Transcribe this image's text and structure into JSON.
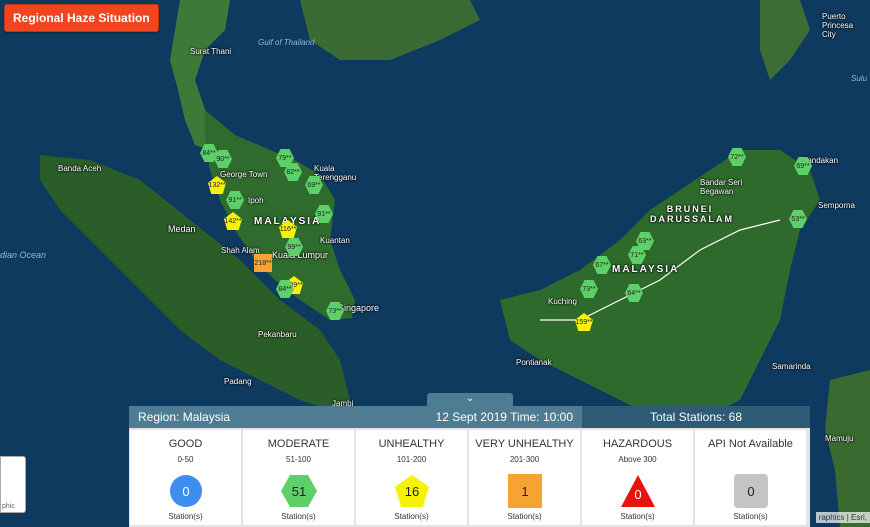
{
  "app": {
    "title_button": "Regional Haze Situation"
  },
  "map": {
    "labels": {
      "gulf": "Gulf of Thailand",
      "surat_thani": "Surat Thani",
      "banda_aceh": "Banda Aceh",
      "medan": "Medan",
      "indian_ocean": "dian Ocean",
      "malaysia_west": "MALAYSIA",
      "george_town": "George Town",
      "ipoh": "Ipoh",
      "kuala_terengganu": "Kuala Terengganu",
      "kuantan": "Kuantan",
      "shah_alam": "Shah Alam",
      "kuala_lumpur": "Kuala Lumpur",
      "singapore": "Singapore",
      "pekanbaru": "Pekanbaru",
      "padang": "Padang",
      "jambi": "Jambi",
      "pontianak": "Pontianak",
      "kuching": "Kuching",
      "malaysia_east": "MALAYSIA",
      "brunei": "BRUNEI DARUSSALAM",
      "bandar": "Bandar Seri Begawan",
      "sandakan": "Sandakan",
      "semporna": "Semporna",
      "samarinda": "Samarinda",
      "mamuju": "Mamuju",
      "puerto": "Puerto Princesa City",
      "sulu": "Sulu"
    },
    "stations": [
      {
        "v": "84**",
        "c": "good"
      },
      {
        "v": "90**",
        "c": "good"
      },
      {
        "v": "132**",
        "c": "unhealthy"
      },
      {
        "v": "91**",
        "c": "good"
      },
      {
        "v": "142**",
        "c": "unhealthy"
      },
      {
        "v": "79**",
        "c": "good"
      },
      {
        "v": "82**",
        "c": "good"
      },
      {
        "v": "69**",
        "c": "good"
      },
      {
        "v": "91**",
        "c": "good"
      },
      {
        "v": "116**",
        "c": "unhealthy"
      },
      {
        "v": "99**",
        "c": "good"
      },
      {
        "v": "218**",
        "c": "very_unhealthy"
      },
      {
        "v": "109**",
        "c": "unhealthy"
      },
      {
        "v": "84**",
        "c": "good"
      },
      {
        "v": "73**",
        "c": "good"
      },
      {
        "v": "67**",
        "c": "good"
      },
      {
        "v": "73**",
        "c": "good"
      },
      {
        "v": "64**",
        "c": "good"
      },
      {
        "v": "71**",
        "c": "good"
      },
      {
        "v": "63**",
        "c": "good"
      },
      {
        "v": "159**",
        "c": "unhealthy"
      },
      {
        "v": "72**",
        "c": "good"
      },
      {
        "v": "53**",
        "c": "good"
      },
      {
        "v": "69**",
        "c": "good"
      }
    ],
    "attribution": "raphics | Esri,",
    "mini_map_text": "phic"
  },
  "panel": {
    "region": "Region: Malaysia",
    "datetime": "12 Sept 2019   Time: 10:00",
    "total": "Total Stations: 68",
    "categories": [
      {
        "name": "GOOD",
        "range": "0-50",
        "count": "0",
        "unit": "Station(s)",
        "color": "#3d8ef0",
        "shape": "circle"
      },
      {
        "name": "MODERATE",
        "range": "51-100",
        "count": "51",
        "unit": "Station(s)",
        "color": "#5ed06a",
        "shape": "hexagon"
      },
      {
        "name": "UNHEALTHY",
        "range": "101-200",
        "count": "16",
        "unit": "Station(s)",
        "color": "#f7f205",
        "shape": "pentagon"
      },
      {
        "name": "VERY UNHEALTHY",
        "range": "201-300",
        "count": "1",
        "unit": "Station(s)",
        "color": "#f6a332",
        "shape": "square"
      },
      {
        "name": "HAZARDOUS",
        "range": "Above 300",
        "count": "0",
        "unit": "Station(s)",
        "color": "#e8130e",
        "shape": "triangle"
      },
      {
        "name": "API Not Available",
        "range": "",
        "count": "0",
        "unit": "Station(s)",
        "color": "#c4c4c4",
        "shape": "rounded-square"
      }
    ]
  }
}
